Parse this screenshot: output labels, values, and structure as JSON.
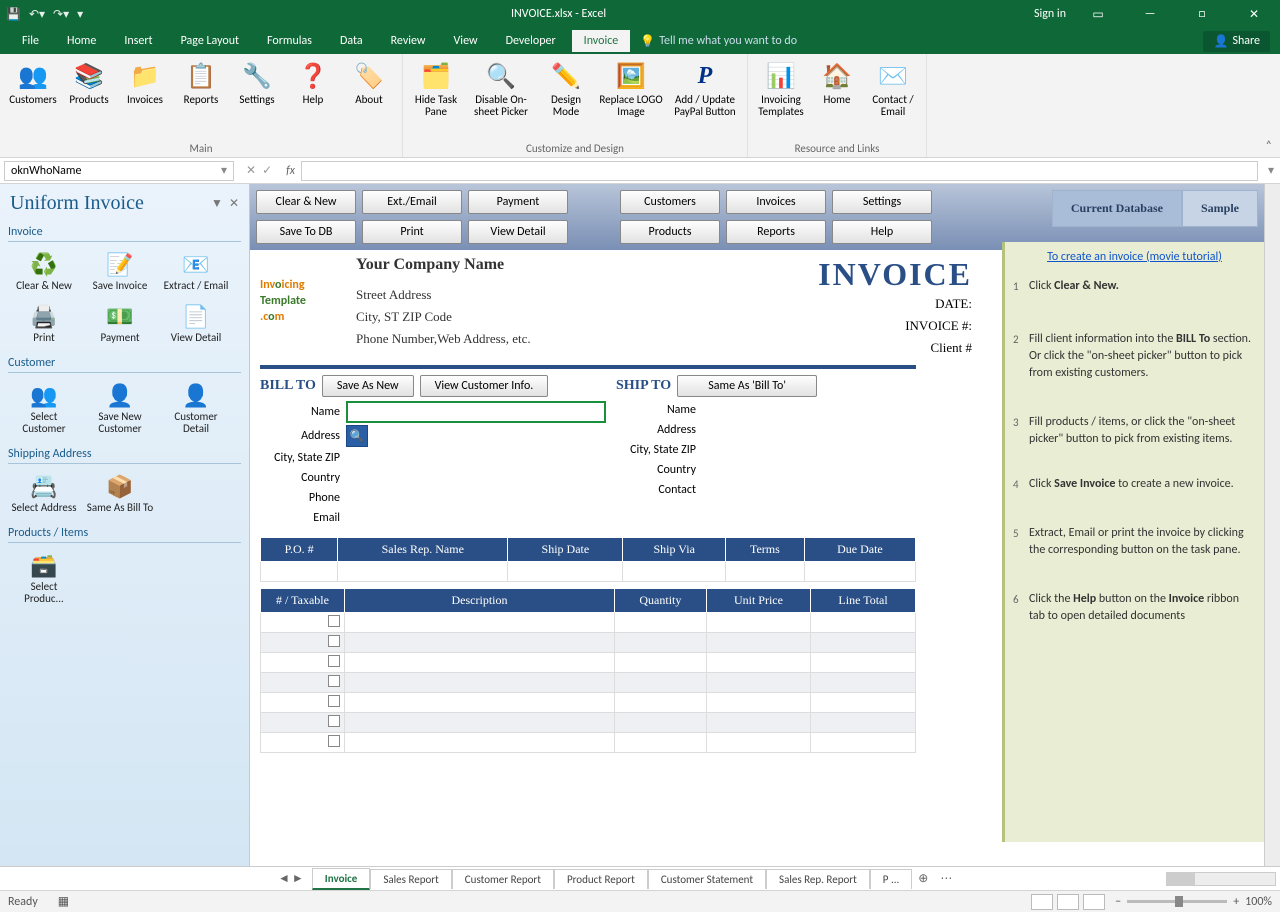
{
  "titlebar": {
    "doc": "INVOICE.xlsx  -  Excel",
    "signin": "Sign in"
  },
  "tabs": {
    "file": "File",
    "home": "Home",
    "insert": "Insert",
    "pagelayout": "Page Layout",
    "formulas": "Formulas",
    "data": "Data",
    "review": "Review",
    "view": "View",
    "developer": "Developer",
    "invoice": "Invoice",
    "tell": "Tell me what you want to do",
    "share": "Share"
  },
  "ribbon": {
    "main": {
      "label": "Main",
      "customers": "Customers",
      "products": "Products",
      "invoices": "Invoices",
      "reports": "Reports",
      "settings": "Settings",
      "help": "Help",
      "about": "About"
    },
    "customize": {
      "label": "Customize and Design",
      "hidetask": "Hide Task Pane",
      "disable": "Disable On-sheet Picker",
      "design": "Design Mode",
      "replace": "Replace LOGO Image",
      "paypal": "Add / Update PayPal Button"
    },
    "resource": {
      "label": "Resource and Links",
      "templates": "Invoicing Templates",
      "home": "Home",
      "contact": "Contact / Email"
    }
  },
  "namebox": "oknWhoName",
  "taskpane": {
    "title": "Uniform Invoice",
    "s_invoice": "Invoice",
    "clearnew": "Clear & New",
    "saveinvoice": "Save Invoice",
    "extract": "Extract / Email",
    "print": "Print",
    "payment": "Payment",
    "viewdetail": "View Detail",
    "s_customer": "Customer",
    "selcust": "Select Customer",
    "savenew": "Save New Customer",
    "custdetail": "Customer Detail",
    "s_ship": "Shipping Address",
    "seladdr": "Select Address",
    "sameas": "Same As Bill To",
    "s_products": "Products / Items",
    "selprod": "Select Produc..."
  },
  "toolbar": {
    "clearnew": "Clear & New",
    "extemail": "Ext./Email",
    "payment": "Payment",
    "savedb": "Save To DB",
    "print": "Print",
    "viewdetail": "View Detail",
    "customers": "Customers",
    "invoices": "Invoices",
    "settings": "Settings",
    "products": "Products",
    "reports": "Reports",
    "help": "Help",
    "curdb": "Current Database",
    "sample": "Sample"
  },
  "invoice": {
    "company": "Your Company Name",
    "addr": "Street Address",
    "csz": "City, ST  ZIP Code",
    "phone": "Phone Number,Web Address, etc.",
    "title": "INVOICE",
    "date": "DATE:",
    "invno": "INVOICE #:",
    "client": "Client #",
    "billto": "BILL TO",
    "shipto": "SHIP TO",
    "saveasnew": "Save As New",
    "viewcust": "View Customer Info.",
    "sameasbill": "Same As 'Bill To'",
    "name": "Name",
    "address": "Address",
    "citystzip": "City, State ZIP",
    "country": "Country",
    "phonel": "Phone",
    "email": "Email",
    "contact": "Contact",
    "hdr1": {
      "po": "P.O. #",
      "rep": "Sales Rep. Name",
      "shipdate": "Ship Date",
      "shipvia": "Ship Via",
      "terms": "Terms",
      "due": "Due Date"
    },
    "hdr2": {
      "tax": "# / Taxable",
      "desc": "Description",
      "qty": "Quantity",
      "price": "Unit Price",
      "total": "Line Total"
    }
  },
  "help": {
    "link": "To create an invoice (movie tutorial)",
    "s1a": "Click ",
    "s1b": "Clear & New.",
    "s2a": "Fill client information into the ",
    "s2b": "BILL To",
    "s2c": " section. Or click the \"on-sheet picker\" button to pick from existing customers.",
    "s3": "Fill products / items, or click the \"on-sheet picker\" button to pick from existing items.",
    "s4a": "Click ",
    "s4b": "Save Invoice",
    "s4c": " to create a new invoice.",
    "s5": "Extract, Email or print the invoice by clicking the corresponding button on the task pane.",
    "s6a": "Click the ",
    "s6b": "Help",
    "s6c": " button on the ",
    "s6d": "Invoice",
    "s6e": " ribbon tab to open detailed documents"
  },
  "sheets": {
    "invoice": "Invoice",
    "sales": "Sales Report",
    "customer": "Customer Report",
    "product": "Product Report",
    "statement": "Customer Statement",
    "salesrep": "Sales Rep. Report",
    "p": "P ..."
  },
  "status": {
    "ready": "Ready",
    "zoom": "100%"
  }
}
